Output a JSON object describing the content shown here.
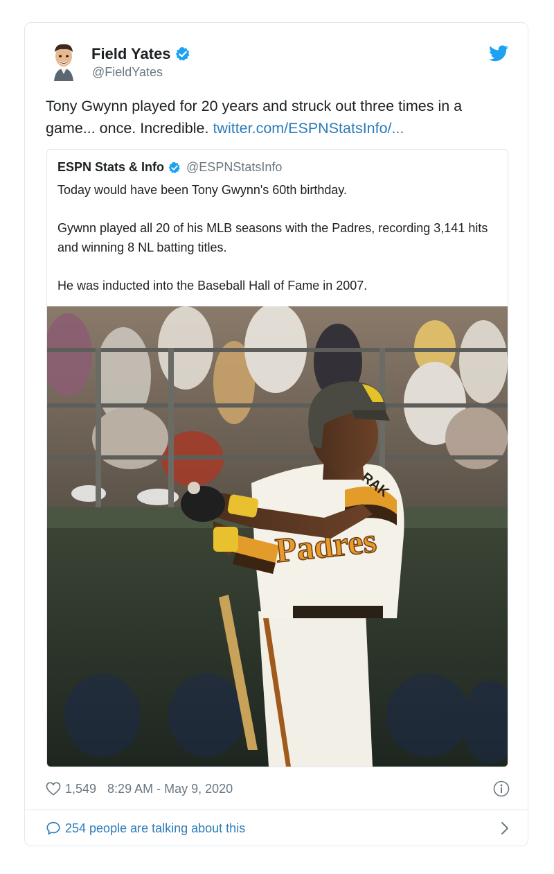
{
  "author": {
    "name": "Field Yates",
    "handle": "@FieldYates"
  },
  "tweet": {
    "text": "Tony Gwynn played for 20 years and struck out three times in a game... once. Incredible.",
    "link": "twitter.com/ESPNStatsInfo/..."
  },
  "quoted": {
    "name": "ESPN Stats & Info",
    "handle": "@ESPNStatsInfo",
    "paragraphs": [
      "Today would have been Tony Gwynn's 60th birthday.",
      "Gywnn played all 20 of his MLB seasons with the Padres, recording 3,141 hits and winning 8 NL batting titles.",
      "He was inducted into the Baseball Hall of Fame in 2007."
    ],
    "photo_jersey_text": "Padres",
    "photo_sleeve_text": "RAK"
  },
  "footer": {
    "likes": "1,549",
    "timestamp": "8:29 AM - May 9, 2020",
    "talking": "254 people are talking about this"
  },
  "colors": {
    "link": "#2b7bb9",
    "muted": "#697882",
    "verified": "#1da1f2",
    "border": "#e1e8ed"
  },
  "icons": [
    "avatar",
    "verified-badge-icon",
    "twitter-bird-icon",
    "heart-icon",
    "info-icon",
    "comment-bubble-icon",
    "chevron-right-icon"
  ]
}
